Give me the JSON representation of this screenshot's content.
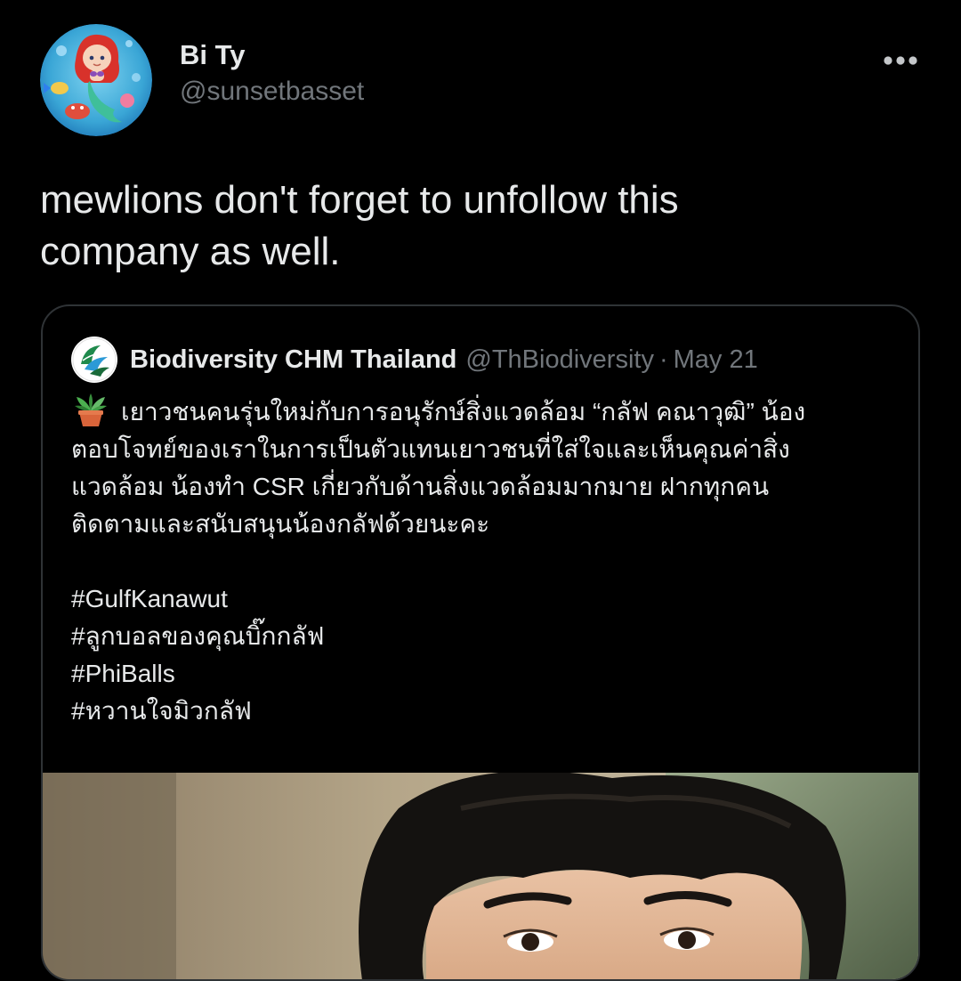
{
  "author": {
    "display_name": "Bi Ty",
    "handle": "@sunsetbasset",
    "avatar_icon": "avatar-mermaid-illustration"
  },
  "tweet": {
    "text_line1": "mewlions don't forget to unfollow this",
    "text_line2": "company as well."
  },
  "quoted": {
    "name": "Biodiversity CHM Thailand",
    "handle": "@ThBiodiversity",
    "separator": "·",
    "date": "May 21",
    "avatar_icon": "biodiversity-logo-icon",
    "lines": [
      "เยาวชนคนรุ่นใหม่กับการอนุรักษ์สิ่งแวดล้อม “กลัฟ คณาวุฒิ” น้อง",
      "ตอบโจทย์ของเราในการเป็นตัวแทนเยาวชนที่ใส่ใจและเห็นคุณค่าสิ่ง",
      "แวดล้อม น้องทำ CSR เกี่ยวกับด้านสิ่งแวดล้อมมากมาย ฝากทุกคน",
      "ติดตามและสนับสนุนน้องกลัฟด้วยนะคะ"
    ],
    "hashtags": [
      "#GulfKanawut",
      "#ลูกบอลของคุณบิ๊กกลัฟ",
      "#PhiBalls",
      "#หวานใจมิวกลัฟ"
    ],
    "emoji_icon": "potted-plant-icon",
    "media_icon": "portrait-photo"
  },
  "colors": {
    "background": "#000000",
    "text": "#e7e9ea",
    "secondary": "#71767b",
    "border": "#2f3336"
  }
}
